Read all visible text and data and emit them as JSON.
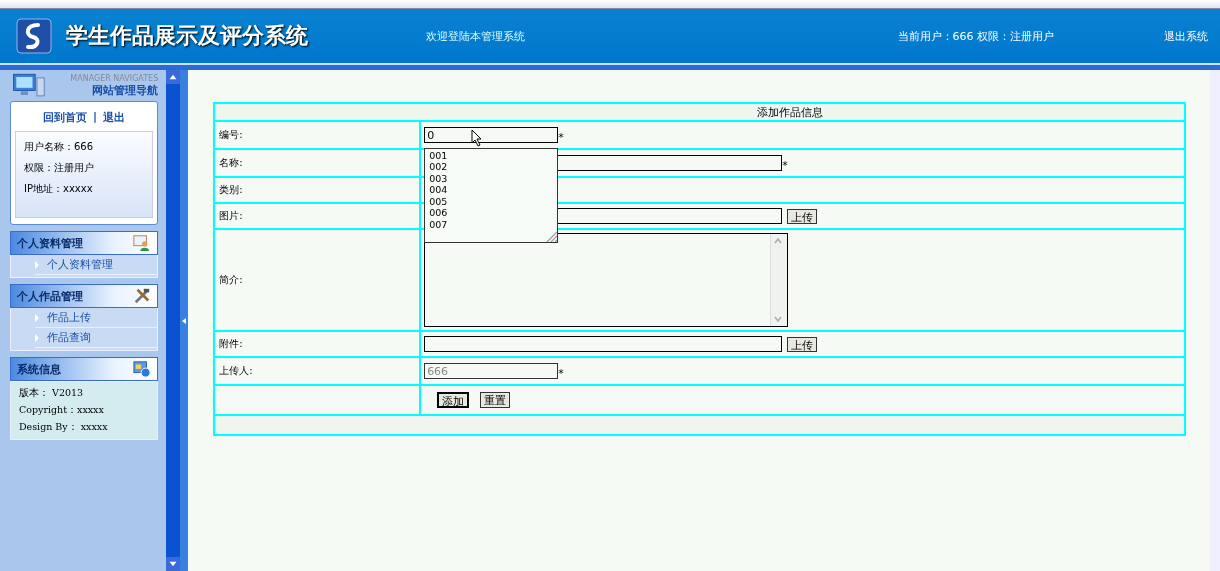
{
  "header": {
    "title": "学生作品展示及评分系统",
    "welcome": "欢迎登陆本管理系统",
    "user_info": "当前用户：666  权限：注册用户",
    "logout": "退出系统"
  },
  "sidebar": {
    "nav_subtitle": "MANAGER NAVIGATES",
    "nav_title": "网站管理导航",
    "links": [
      "回到首页",
      "退出"
    ],
    "link_separator": "|",
    "user_lines": [
      "用户名称：666",
      "权限：注册用户",
      "IP地址：xxxxx"
    ],
    "sections": [
      {
        "title": "个人资料管理",
        "kind": "profile",
        "items": [
          "个人资料管理"
        ]
      },
      {
        "title": "个人作品管理",
        "kind": "tools",
        "items": [
          "作品上传",
          "作品查询"
        ]
      }
    ],
    "system_info": {
      "title": "系统信息",
      "lines": [
        "版本： V2013",
        "Copyright：xxxxx",
        "Design By： xxxxx"
      ]
    }
  },
  "form": {
    "title": "添加作品信息",
    "fields": [
      {
        "label": "编号:",
        "kind": "text",
        "wide": false,
        "value": "0",
        "mark": "*",
        "disabled": false
      },
      {
        "label": "名称:",
        "kind": "text",
        "wide": true,
        "mark": "*",
        "disabled": false
      },
      {
        "label": "类别:",
        "kind": "hidden"
      },
      {
        "label": "图片:",
        "kind": "upload",
        "button": "上传"
      },
      {
        "label": "简介:",
        "kind": "textarea"
      },
      {
        "label": "附件:",
        "kind": "upload",
        "button": "上传"
      },
      {
        "label": "上传人:",
        "kind": "text",
        "wide": false,
        "value": "666",
        "mark": "*",
        "disabled": true
      }
    ],
    "autocomplete": [
      "001",
      "002",
      "003",
      "004",
      "005",
      "006",
      "007"
    ],
    "buttons": [
      {
        "label": "添加",
        "selected": true
      },
      {
        "label": "重置",
        "selected": false
      }
    ]
  }
}
